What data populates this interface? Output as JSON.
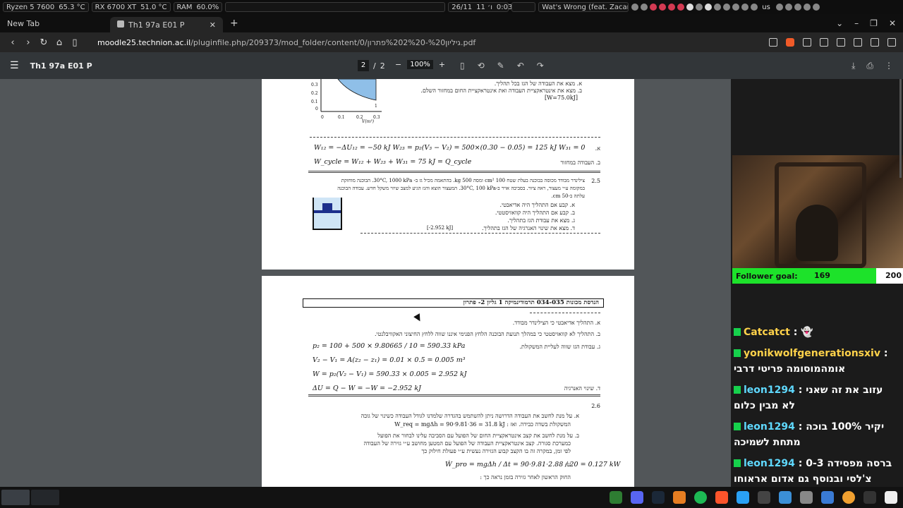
{
  "sysbar": {
    "cpu": "Ryzen 5 7600",
    "cpu_temp": "65.3 °C",
    "gpu": "RX 6700 XT",
    "gpu_temp": "51.0 °C",
    "ram_label": "RAM",
    "ram_pct": "60.0%",
    "date": "26/11",
    "hebrew_date": "ו׳ 11",
    "time": "0:03",
    "media": "Wat's Wrong (feat. Zacari &",
    "keyboard": "us"
  },
  "tabs": {
    "new_tab": "New Tab",
    "active_tab": "Th1 97a E01 P"
  },
  "address": {
    "domain": "moodle25.technion.ac.il",
    "path": "/pluginfile.php/209373/mod_folder/content/0/גיליון%20-%202%20פתרון.pdf"
  },
  "pdf": {
    "title": "Th1 97a E01 P",
    "page_current": "2",
    "page_sep": "/",
    "page_total": "2",
    "zoom": "100%"
  },
  "page1": {
    "q_a": "א.   מצא את העבודה של הגז בכל תהליך.",
    "q_b": "ב.   מצא את אינטראקציית העבודה ואת אינטראקציית החום במחזור השלם.",
    "q_ans": "[W=75.0kJ]",
    "eq_a": "W₁₂ = −ΔU₁₂ = −50 kJ        W₂₃ = p₂(V₃ − V₂) = 500×(0.30 − 0.05) = 125 kJ        W₃₁ = 0",
    "eq_a_label": "א.",
    "eq_b": "W_cycle = W₁₂ + W₂₃ + W₃₁ = 75 kJ = Q_cycle",
    "eq_b_label": "ב.   העבודה במחזור",
    "q25_num": "2.5",
    "q25_text1": "צילינדר מבודד מכוסה בבוכנה בעלת שטח 100 cm² ומסה 500 kg. בהתאמה מכיל גז ב- 30°C, 1000 kPa. הבוכנה מוחזקת",
    "q25_text2": "במקומה ע״י מעצור, ראה ציור. בסביבה אויר ב-30°C, 100 kPa. המעצור הוצא והגז הגיע למצב שיווי משקל חדש. עבודה הבוכנה",
    "q25_text3": "עלתה ב-50 cm.",
    "q25_a": "א.   קבע אם התהליך היה אדיאבטי.",
    "q25_b": "ב.   קבע אם התהליך היה קוואזיסטטי.",
    "q25_c": "ג.   מצא את עבודת הגז בתהליך.",
    "q25_d": "ד.   מצא את שינוי האנרגיה של הגז בתהליך.",
    "q25_ans": "[-2.952 kJ]"
  },
  "page2": {
    "header": "הנדסת מכונות   034-035   תרמודינמיקה 1     גליון 2- פתרון",
    "a_line": "א.   התהליך אדיאבטי כי הצילינדר מבודד.",
    "b_line": "ב.   התהליך לא קוואזיסטטי כי במהלך תנועת הבוכנה הלחץ הפנימי איננו שווה ללחץ החיצוני האקוויבלנטי.",
    "c_label": "ג.   עבודת הגז שווה לעליית המשקולת.",
    "c_eq1": "p₂ = 100 + 500 × 9.80665 / 10 = 590.33 kPa",
    "c_eq2": "V₂ − V₁ = A(z₂ − z₁) = 0.01 × 0.5 = 0.005 m³",
    "c_eq3": "W = p₂(V₂ − V₁) = 590.33 × 0.005 = 2.952 kJ",
    "d_eq": "ΔU = Q − W = −W = −2.952 kJ",
    "d_label": "ד.   שינוי האנרגיה",
    "q26_num": "2.6",
    "q26_a1": "א.   על מנת לחשב את העבודה הדרושה ניתן להשתמש בהגדרה שלמדנו לגודל העבודה כשינוי של גובה",
    "q26_a2": "המשקולת בשדה כבידה. ואז :  W_req = mgΔh = 90·9.81·36 = 31.8 kJ",
    "q26_b1": "ב.   על מנת לחשב את קצב אינטראקציית החום של הפועל עם הסביבה עלינו לבחור את הפועל",
    "q26_b2": "כמערכת סגורה. קצב אינטראקציית העבודה של הפועל עם המטען מחושב ע״י גזירה של העבודה",
    "q26_b3": "לפי זמן, במקרה זה בו הקצב קבוע הגזירה נעשית ע״י פעולת חילוק כך",
    "q26_eq": "Ẇ_pro = mgΔh / Δt = 90·9.81·2.88 / 20 = 0.127 kW",
    "q26_eq_label": "ש:",
    "q26_last": "החוק הראשון לאחר גזירה בזמן נראה כך :"
  },
  "overlay": {
    "goal_label": "Follower goal:",
    "goal_current": "169",
    "goal_max": "200",
    "goal_fraction": 0.845,
    "chat": [
      {
        "nick": "Catcatct",
        "text": ": 👻",
        "blue": false
      },
      {
        "nick": "yonikwolfgenerationsxiv",
        "text": ": אומהמוסומה פריטי דרבי",
        "blue": false
      },
      {
        "nick": "leon1294",
        "text": ": עזוב את זה שאני לא מבין כלום",
        "blue": true
      },
      {
        "nick": "leon1294",
        "text": ": יקיר 100% בוכה מתחת לשמיכה",
        "blue": true
      },
      {
        "nick": "leon1294",
        "text": ": ברסה מפסידה 0-3 צ'לסי ובנוסף גם אדום אראוחו",
        "blue": true
      }
    ]
  }
}
